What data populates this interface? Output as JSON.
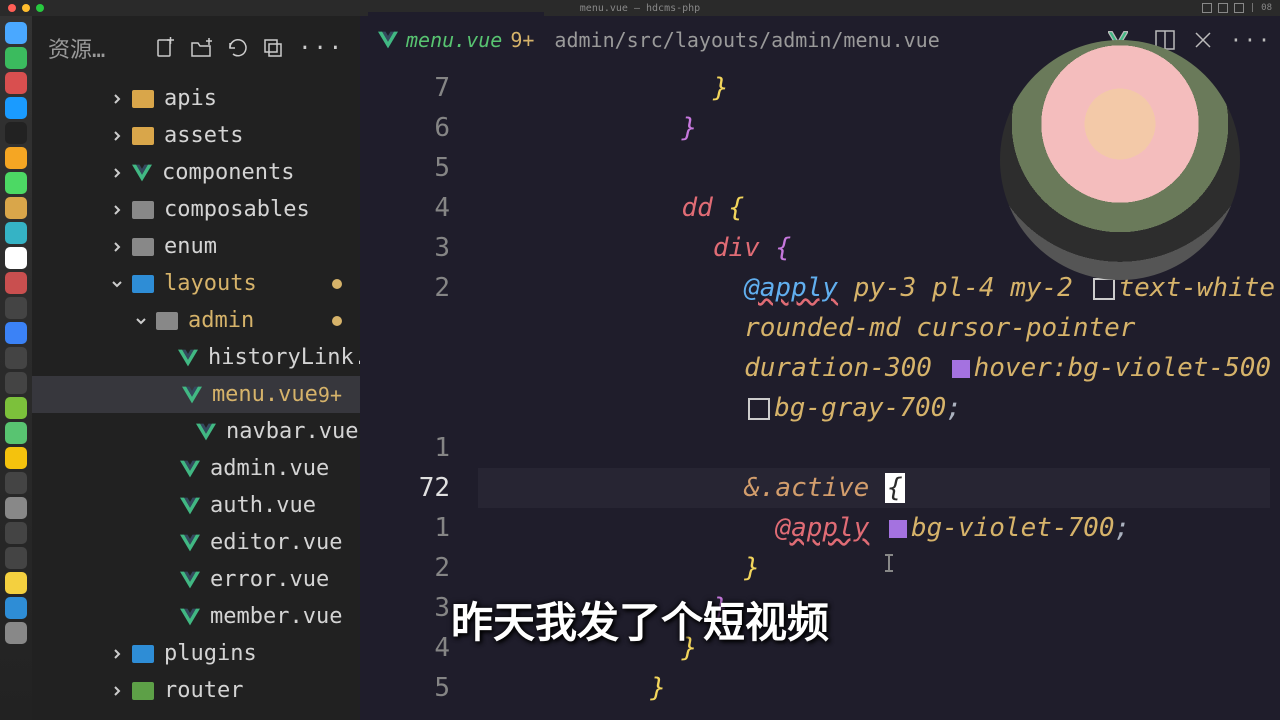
{
  "titlebar": {
    "title": "menu.vue — hdcms-php",
    "right": "08"
  },
  "dock_colors": [
    "#4aa8ff",
    "#3bbb5e",
    "#d94f4f",
    "#1a9bff",
    "#222",
    "#f5a623",
    "#4cd964",
    "#d9a64a",
    "#35b3c5",
    "#fff",
    "#c94f4f",
    "#444",
    "#3b82f6",
    "#444",
    "#444",
    "#7cc13b",
    "#58c471",
    "#f4c20d",
    "#444",
    "#888",
    "#444",
    "#444",
    "#f4d03f",
    "#2e8dd6",
    "#888"
  ],
  "sidebar": {
    "title": "资源…",
    "tree": [
      {
        "indent": 76,
        "chev": "r",
        "icon": "folder",
        "color": "fyellow",
        "label": "apis"
      },
      {
        "indent": 76,
        "chev": "r",
        "icon": "folder",
        "color": "fyellow",
        "label": "assets"
      },
      {
        "indent": 76,
        "chev": "r",
        "icon": "vue",
        "label": "components"
      },
      {
        "indent": 76,
        "chev": "r",
        "icon": "folder",
        "color": "fgray",
        "label": "composables"
      },
      {
        "indent": 76,
        "chev": "r",
        "icon": "folder",
        "color": "fgray",
        "label": "enum"
      },
      {
        "indent": 76,
        "chev": "d",
        "icon": "folder",
        "color": "fblue",
        "label": "layouts",
        "mod": true,
        "dot": true
      },
      {
        "indent": 100,
        "chev": "d",
        "icon": "folder",
        "color": "fgray",
        "label": "admin",
        "mod": true,
        "dot": true
      },
      {
        "indent": 140,
        "icon": "vue",
        "label": "historyLink.vue"
      },
      {
        "indent": 140,
        "icon": "vue",
        "label": "menu.vue",
        "mod": true,
        "sel": true,
        "badge": "9+"
      },
      {
        "indent": 140,
        "icon": "vue",
        "label": "navbar.vue"
      },
      {
        "indent": 124,
        "icon": "vue",
        "label": "admin.vue"
      },
      {
        "indent": 124,
        "icon": "vue",
        "label": "auth.vue"
      },
      {
        "indent": 124,
        "icon": "vue",
        "label": "editor.vue"
      },
      {
        "indent": 124,
        "icon": "vue",
        "label": "error.vue"
      },
      {
        "indent": 124,
        "icon": "vue",
        "label": "member.vue"
      },
      {
        "indent": 76,
        "chev": "r",
        "icon": "folder",
        "color": "fblue",
        "label": "plugins"
      },
      {
        "indent": 76,
        "chev": "r",
        "icon": "folder",
        "color": "green",
        "label": "router"
      }
    ]
  },
  "tab": {
    "name": "menu.vue",
    "status": "9+",
    "path": "admin/src/layouts/admin/menu.vue"
  },
  "gutter": [
    "7",
    "6",
    "5",
    "4",
    "3",
    "2",
    "",
    "",
    "",
    "1",
    "72",
    "1",
    "2",
    "3",
    "4",
    "5"
  ],
  "gutter_cur": 10,
  "code": {
    "apply1a": "@apply",
    "apply1b": "py-3 pl-4 my-2",
    "apply1c": "text-white",
    "apply2": "rounded-md cursor-pointer",
    "apply3a": "duration-300",
    "apply3b": "hover:bg-violet-500",
    "apply4": "bg-gray-700",
    "active": "&.active",
    "apply5": "@apply",
    "apply5b": "bg-violet-700",
    "dd": "dd",
    "div": "div"
  },
  "subtitle": "昨天我发了个短视频"
}
